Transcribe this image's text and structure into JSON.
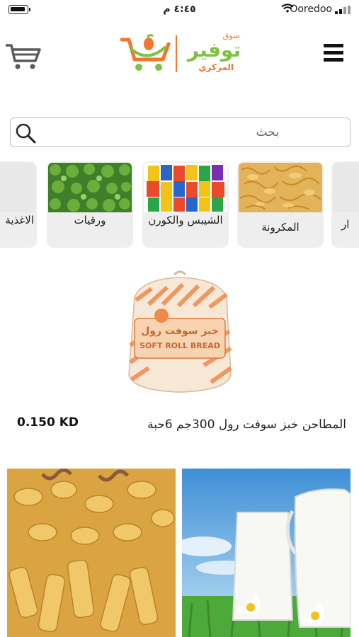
{
  "status_bar": {
    "time": "٤:٤٥ م",
    "carrier": "Ooredoo"
  },
  "header": {
    "logo": {
      "top_text": "سوق",
      "main_text": "توفير",
      "bottom_text": "المركزي"
    },
    "cart_icon": "cart-icon",
    "menu_icon": "hamburger-icon"
  },
  "search": {
    "placeholder": "بحث",
    "value": ""
  },
  "categories": [
    {
      "label": "ار",
      "partial": true
    },
    {
      "label": "المكرونة"
    },
    {
      "label": "الشيبس والكورن"
    },
    {
      "label": "ورقيات"
    },
    {
      "label": "الاغذية",
      "partial": true
    }
  ],
  "featured_product": {
    "name": "المطاحن خبز سوفت رول 300جم 6حبة",
    "price": "0.150 KD",
    "package_text": "SOFT ROLL BREAD"
  },
  "banners": [
    {
      "name": "milk-banner"
    },
    {
      "name": "pasta-banner"
    }
  ],
  "colors": {
    "logo_green": "#7cc243",
    "logo_orange": "#f2762e",
    "card_bg": "#eeeeee"
  }
}
